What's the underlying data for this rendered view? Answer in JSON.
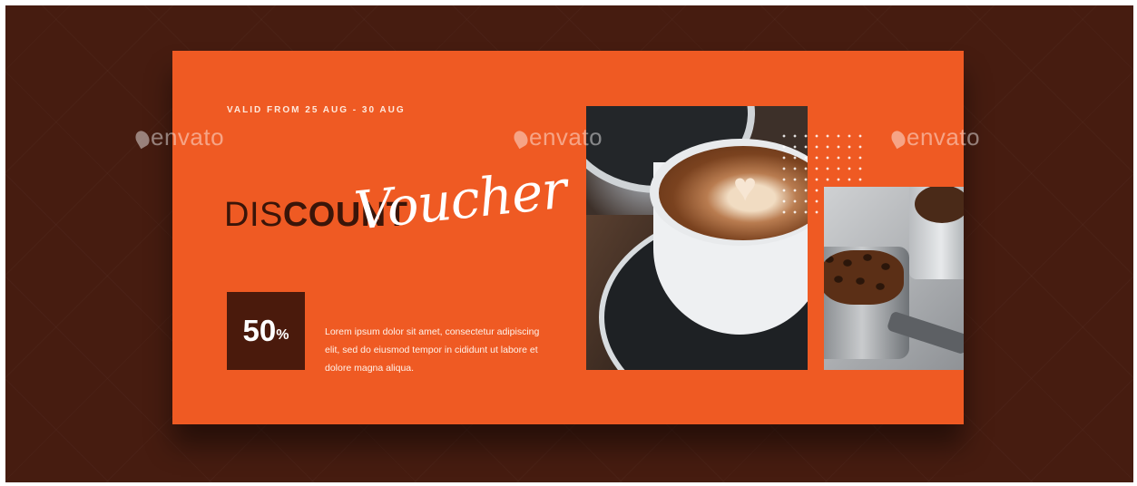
{
  "voucher": {
    "validity": "VALID FROM 25 AUG - 30 AUG",
    "title_light": "DIS",
    "title_bold": "COUNT",
    "script_word": "Voucher",
    "discount_value": "50",
    "discount_symbol": "%",
    "description": "Lorem ipsum dolor sit amet, consectetur adipiscing elit, sed do eiusmod tempor in cididunt ut labore et dolore magna aliqua."
  },
  "watermarks": [
    "envato",
    "envato",
    "envato"
  ],
  "colors": {
    "background": "#461c10",
    "card": "#ef5a23",
    "accent_dark": "#4a1a0c",
    "text_light": "#ffffff"
  },
  "icons": [
    "envato-leaf-icon"
  ]
}
